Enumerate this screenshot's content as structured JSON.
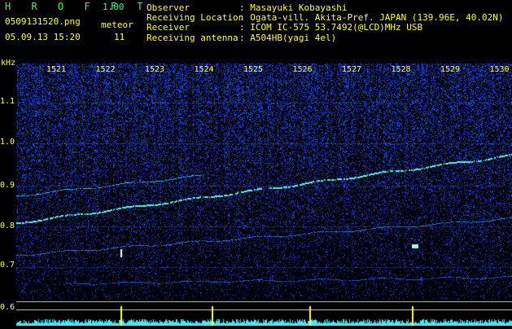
{
  "header": {
    "app_title": "H R O F F T",
    "version": "1.00",
    "filename": "0509131520.png",
    "meteor_label": "meteor",
    "meteor_count": "11",
    "datetime": "05.09.13 15:20",
    "observer_label": "Observer",
    "observer_value": ": Masayuki Kobayashi",
    "location_label": "Receiving Location",
    "location_value": ": Ogata-vill. Akita-Pref. JAPAN (139.96E, 40.02N)",
    "receiver_label": "Receiver",
    "receiver_value": ": ICOM IC-575 53.7492(@LCD)MHz USB",
    "antenna_label": "Receiving antenna",
    "antenna_value": ": A504HB(yagi 4el)"
  },
  "spectrogram": {
    "freq_unit": "kHz",
    "freq_labels": [
      "1.1",
      "1.0",
      "0.9",
      "0.8",
      "0.7",
      "0.6"
    ],
    "minute_labels": [
      "1521",
      "1522",
      "1523",
      "1524",
      "1525",
      "1526",
      "1527",
      "1528",
      "1529",
      "1530"
    ],
    "colors": {
      "background": "#000010",
      "noise": "#2340d8",
      "signal": "#7fffe0",
      "label": "#ffff3a"
    }
  }
}
